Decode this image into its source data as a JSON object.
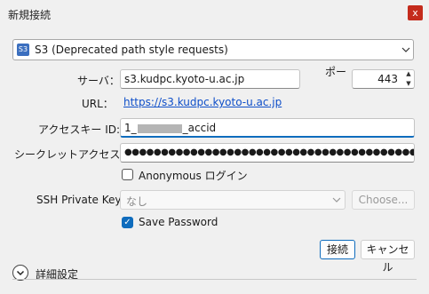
{
  "window": {
    "title": "新規接続",
    "close_label": "x"
  },
  "protocol": {
    "selected": "S3 (Deprecated path style requests)",
    "icon_text": "S3"
  },
  "server": {
    "label": "サーバ：",
    "value": "s3.kudpc.kyoto-u.ac.jp"
  },
  "port": {
    "label": "ポー",
    "value": "443"
  },
  "url": {
    "label": "URL：",
    "value": "https://s3.kudpc.kyoto-u.ac.jp"
  },
  "access_key": {
    "label": "アクセスキー ID:",
    "prefix": "1_",
    "suffix": "_accid"
  },
  "secret_key": {
    "label": "シークレットアクセスキー:",
    "value": "●●●●●●●●●●●●●●●●●●●●●●●●●●●●●●●●●●●●●●●●"
  },
  "anonymous": {
    "label": "Anonymous ログイン",
    "checked": false
  },
  "ssh_key": {
    "label": "SSH Private Key:",
    "value": "なし",
    "choose_label": "Choose..."
  },
  "save_password": {
    "label": "Save Password",
    "checked": true
  },
  "buttons": {
    "connect": "接続",
    "cancel": "キャンセル"
  },
  "advanced": {
    "label": "詳細設定"
  },
  "colors": {
    "accent": "#0f6cbd",
    "close": "#c42b1c",
    "link": "#0f4fc9"
  }
}
